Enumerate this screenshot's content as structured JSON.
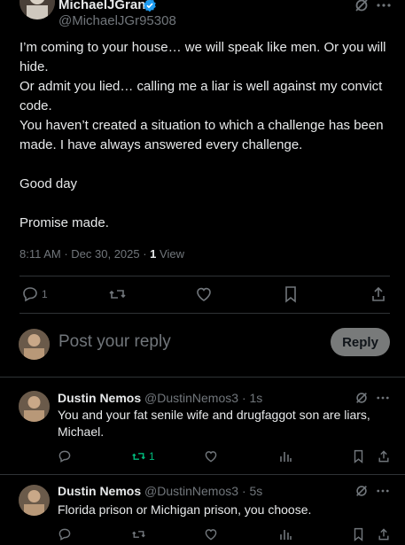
{
  "main_tweet": {
    "name": "MichaelJGrant",
    "handle": "@MichaelJGr95308",
    "text": "I’m coming to your house… we will speak like men. Or you will hide.\nOr admit you lied… calling me a liar is well against my convict code.\nYou haven’t created a situation to which a challenge has been made. I have always answered every challenge.\n\nGood day\n\nPromise made.",
    "time": "8:11 AM · Dec 30, 2025 · ",
    "views_count": "1",
    "views_label": " View",
    "replies": "1"
  },
  "reply_box": {
    "placeholder": "Post your reply",
    "button": "Reply"
  },
  "replies": [
    {
      "name": "Dustin Nemos",
      "handle": "@DustinNemos3",
      "time": "· 1s",
      "text": "You and your fat senile wife and drugfaggot son are liars, Michael.",
      "reposts": "1"
    },
    {
      "name": "Dustin Nemos",
      "handle": "@DustinNemos3",
      "time": "· 5s",
      "text": "Florida prison or Michigan prison, you choose."
    }
  ],
  "colors": {
    "verified": "#1d9bf0",
    "repost_active": "#00ba7c",
    "muted": "#71767b"
  }
}
